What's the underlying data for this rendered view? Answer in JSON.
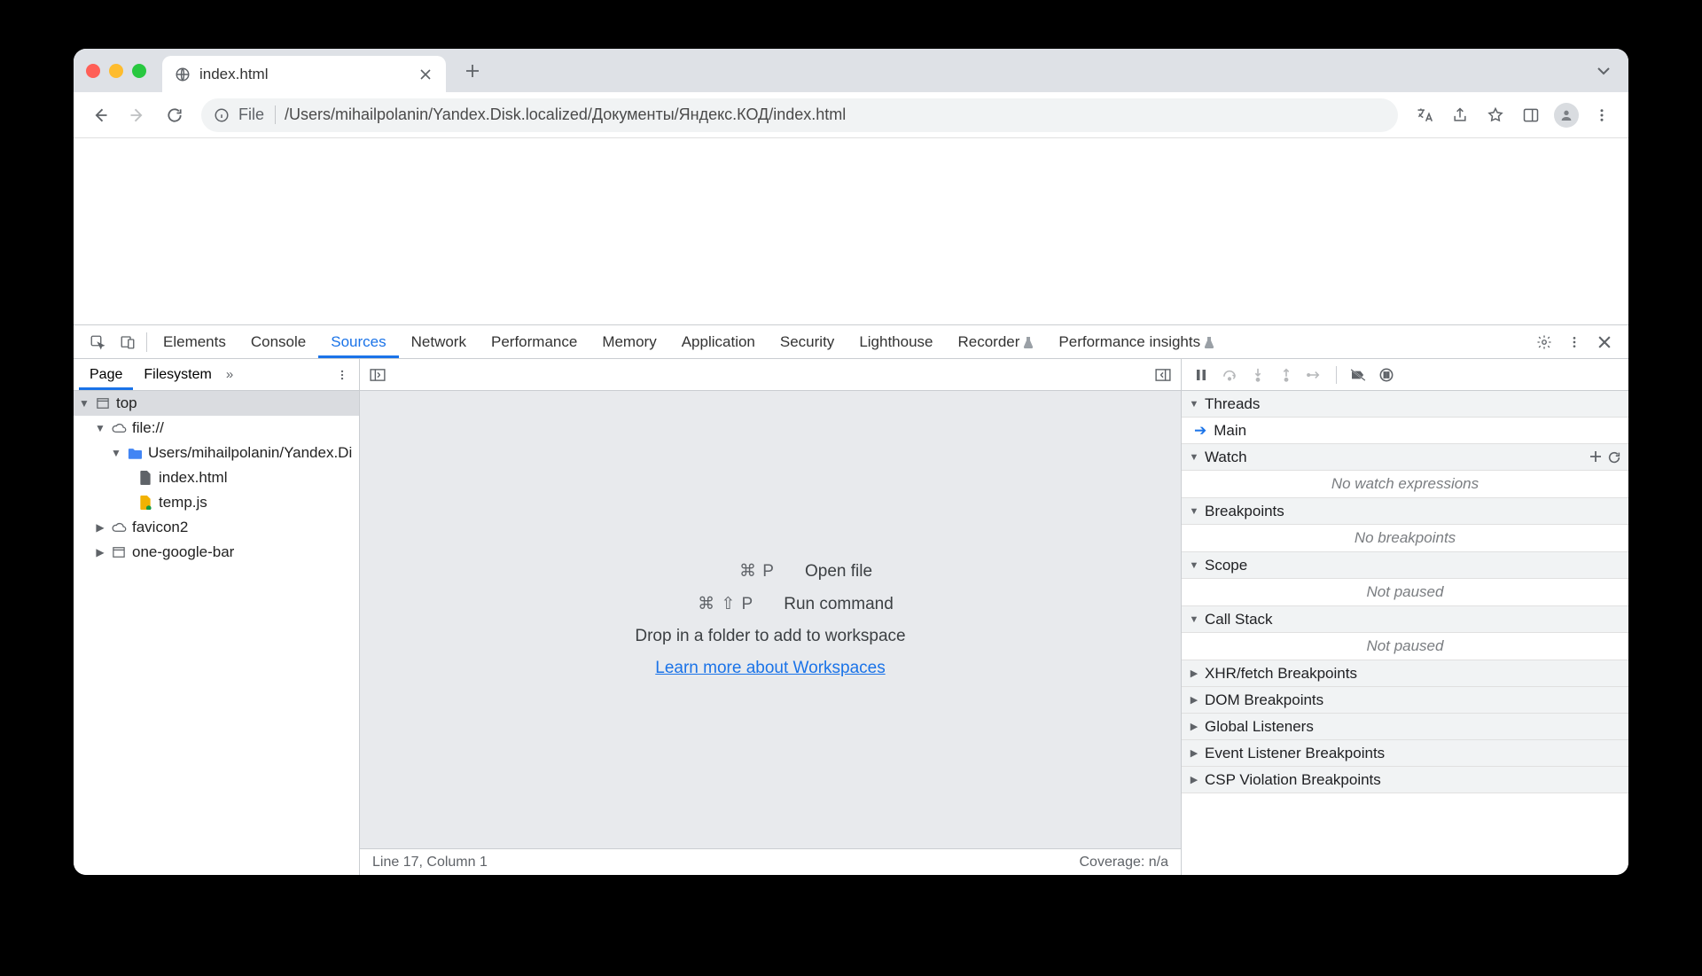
{
  "tab": {
    "title": "index.html"
  },
  "omnibox": {
    "scheme": "File",
    "path": "/Users/mihailpolanin/Yandex.Disk.localized/Документы/Яндекс.КОД/index.html"
  },
  "devtools": {
    "tabs": [
      "Elements",
      "Console",
      "Sources",
      "Network",
      "Performance",
      "Memory",
      "Application",
      "Security",
      "Lighthouse",
      "Recorder",
      "Performance insights"
    ],
    "activeTab": "Sources"
  },
  "sourcesLeft": {
    "tabs": [
      "Page",
      "Filesystem"
    ],
    "activeTab": "Page",
    "tree": {
      "top": "top",
      "file": "file://",
      "folder": "Users/mihailpolanin/Yandex.Di",
      "indexHtml": "index.html",
      "tempJs": "temp.js",
      "favicon2": "favicon2",
      "oneGoogleBar": "one-google-bar"
    }
  },
  "sourcesCenter": {
    "openFileShortcut": "⌘ P",
    "openFileLabel": "Open file",
    "runCmdShortcut": "⌘ ⇧ P",
    "runCmdLabel": "Run command",
    "dropText": "Drop in a folder to add to workspace",
    "learnMore": "Learn more about Workspaces",
    "statusLine": "Line 17, Column 1",
    "coverage": "Coverage: n/a"
  },
  "rightPanel": {
    "threads": {
      "label": "Threads",
      "main": "Main"
    },
    "watch": {
      "label": "Watch",
      "empty": "No watch expressions"
    },
    "breakpoints": {
      "label": "Breakpoints",
      "empty": "No breakpoints"
    },
    "scope": {
      "label": "Scope",
      "empty": "Not paused"
    },
    "callStack": {
      "label": "Call Stack",
      "empty": "Not paused"
    },
    "xhr": {
      "label": "XHR/fetch Breakpoints"
    },
    "dom": {
      "label": "DOM Breakpoints"
    },
    "global": {
      "label": "Global Listeners"
    },
    "evt": {
      "label": "Event Listener Breakpoints"
    },
    "csp": {
      "label": "CSP Violation Breakpoints"
    }
  }
}
